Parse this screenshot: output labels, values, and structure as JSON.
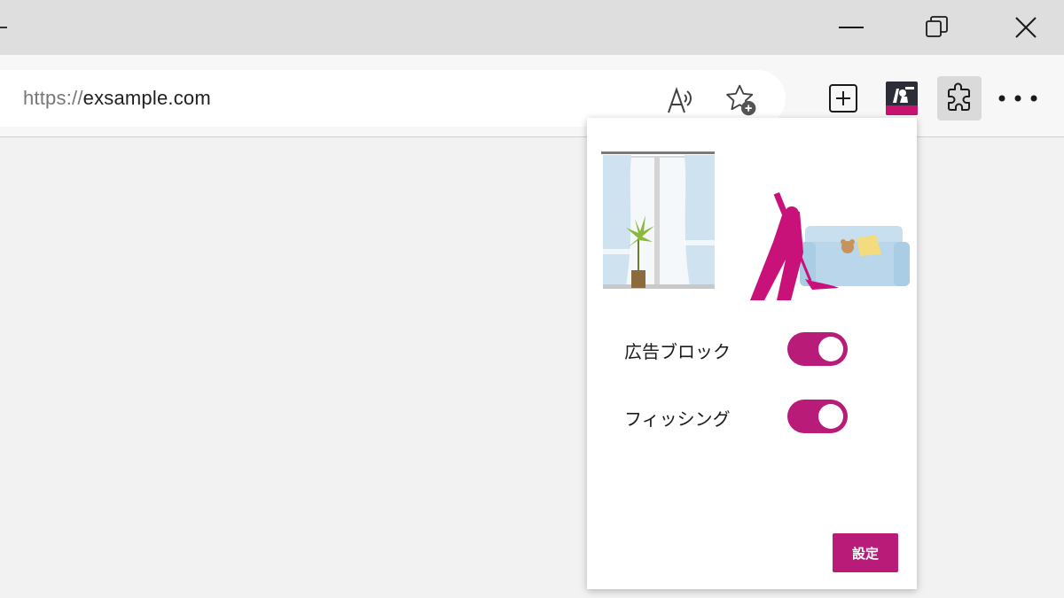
{
  "browser": {
    "url_scheme": "https://",
    "url_host": "exsample.com",
    "icons": {
      "read_aloud": "read-aloud-icon",
      "add_favorite": "add-favorite-icon",
      "new_tab": "new-tab-icon",
      "extension_app": "ad-blocker-extension-icon",
      "extensions": "extensions-puzzle-icon",
      "more": "more-options-icon",
      "minimize": "minimize-icon",
      "maximize": "restore-icon",
      "close": "close-icon"
    }
  },
  "popup": {
    "toggles": [
      {
        "label": "広告ブロック",
        "enabled": true
      },
      {
        "label": "フィッシング",
        "enabled": true
      }
    ],
    "settings_label": "設定",
    "accent_color": "#b81b78"
  }
}
